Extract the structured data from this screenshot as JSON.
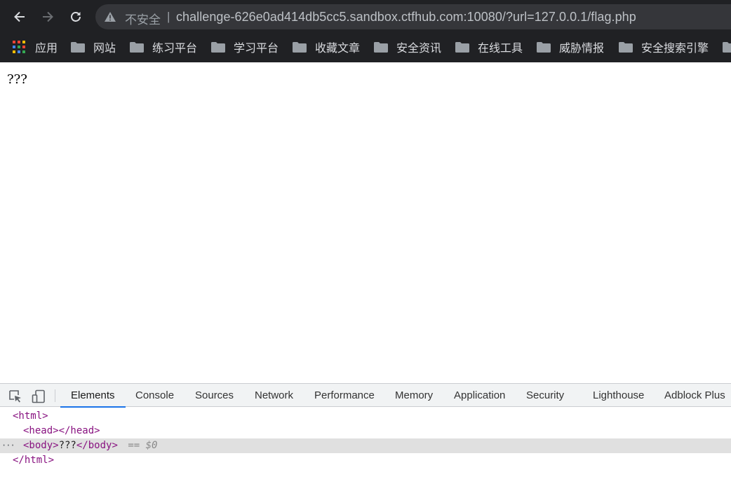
{
  "browser": {
    "security_label": "不安全",
    "separator": "|",
    "url": "challenge-626e0ad414db5cc5.sandbox.ctfhub.com:10080/?url=127.0.0.1/flag.php",
    "icons": {
      "back": "arrow-left-icon",
      "forward": "arrow-right-icon",
      "reload": "reload-icon",
      "warning": "warning-triangle-icon",
      "apps": "apps-grid-icon",
      "folder": "folder-icon"
    },
    "colors": {
      "chrome_bg": "#202124",
      "omnibox_bg": "#35363a",
      "text": "#dadce0"
    }
  },
  "bookmarks": {
    "apps_label": "应用",
    "items": [
      {
        "label": "网站"
      },
      {
        "label": "练习平台"
      },
      {
        "label": "学习平台"
      },
      {
        "label": "收藏文章"
      },
      {
        "label": "安全资讯"
      },
      {
        "label": "在线工具"
      },
      {
        "label": "威胁情报"
      },
      {
        "label": "安全搜索引擎"
      }
    ]
  },
  "page": {
    "body_text": "???"
  },
  "devtools": {
    "tabs": [
      {
        "label": "Elements",
        "active": true
      },
      {
        "label": "Console"
      },
      {
        "label": "Sources"
      },
      {
        "label": "Network"
      },
      {
        "label": "Performance"
      },
      {
        "label": "Memory"
      },
      {
        "label": "Application"
      },
      {
        "label": "Security"
      },
      {
        "label": "Lighthouse"
      },
      {
        "label": "Adblock Plus"
      }
    ],
    "dom": {
      "html_open": "<html>",
      "head_open": "<head>",
      "head_close": "</head>",
      "body_open": "<body>",
      "body_text": "???",
      "body_close": "</body>",
      "selected_marker": "== $0",
      "html_close": "</html>",
      "ellipsis": "···"
    },
    "colors": {
      "tab_bar_bg": "#f1f3f4",
      "active_underline": "#1a73e8",
      "tag_color": "#881280",
      "selected_row_bg": "#e0e0e0"
    }
  }
}
